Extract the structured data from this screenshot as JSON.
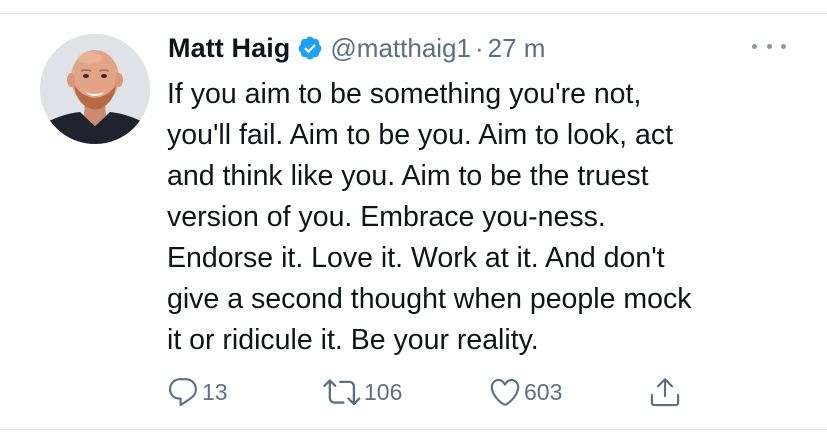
{
  "tweet": {
    "author_name": "Matt Haig",
    "handle": "@matthaig1",
    "separator": "·",
    "timestamp": "27 m",
    "lines": [
      "If you aim to be something you're not,",
      "you'll fail. Aim to be you. Aim to look, act",
      "and think like you. Aim to be the truest",
      "version of you. Embrace you-ness.",
      "Endorse it. Love it. Work at it. And don't",
      "give a second thought when people mock",
      "it or ridicule it. Be your reality."
    ],
    "reply_count": "13",
    "retweet_count": "106",
    "like_count": "603"
  },
  "icons": {
    "verified": "verified-badge-icon",
    "more": "more-options-icon",
    "reply": "reply-icon",
    "retweet": "retweet-icon",
    "like": "heart-icon",
    "share": "share-icon"
  },
  "colors": {
    "text_primary": "#0f1419",
    "text_secondary": "#5b7083",
    "verified_blue": "#1da1f2",
    "divider": "#e6ecf0"
  }
}
